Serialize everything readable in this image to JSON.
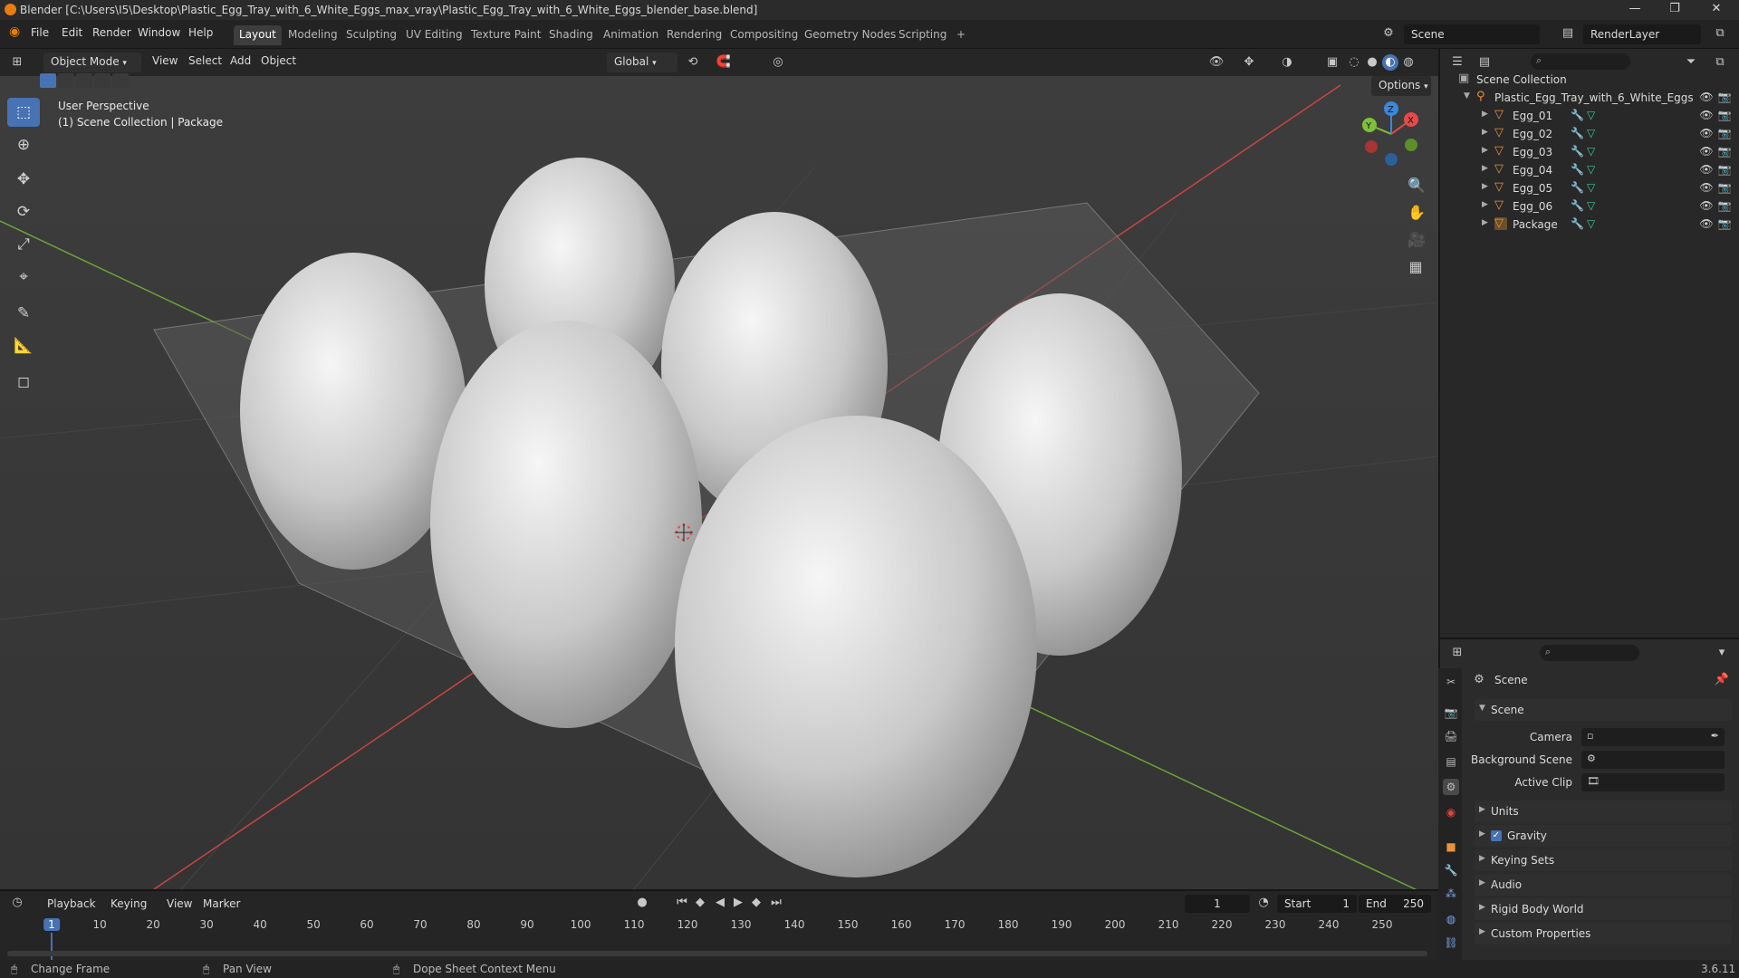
{
  "window": {
    "title": "Blender [C:\\Users\\I5\\Desktop\\Plastic_Egg_Tray_with_6_White_Eggs_max_vray\\Plastic_Egg_Tray_with_6_White_Eggs_blender_base.blend]"
  },
  "menubar": {
    "items": [
      "File",
      "Edit",
      "Render",
      "Window",
      "Help"
    ]
  },
  "workspaces": {
    "tabs": [
      "Layout",
      "Modeling",
      "Sculpting",
      "UV Editing",
      "Texture Paint",
      "Shading",
      "Animation",
      "Rendering",
      "Compositing",
      "Geometry Nodes",
      "Scripting"
    ],
    "active": "Layout",
    "add": "+"
  },
  "scene_selector": {
    "scene": "Scene",
    "view_layer": "RenderLayer"
  },
  "viewport_header": {
    "mode": "Object Mode",
    "menus": [
      "View",
      "Select",
      "Add",
      "Object"
    ],
    "transform_orientation": "Global",
    "options": "Options"
  },
  "viewport": {
    "perspective": "User Perspective",
    "collection_info": "(1) Scene Collection | Package",
    "gizmo_axes": [
      "X",
      "Y",
      "Z"
    ]
  },
  "outliner": {
    "root": "Scene Collection",
    "collection": "Plastic_Egg_Tray_with_6_White_Eggs",
    "objects": [
      "Egg_01",
      "Egg_02",
      "Egg_03",
      "Egg_04",
      "Egg_05",
      "Egg_06",
      "Package"
    ]
  },
  "properties": {
    "context_title": "Scene",
    "panel": "Scene",
    "fields": [
      {
        "label": "Camera"
      },
      {
        "label": "Background Scene"
      },
      {
        "label": "Active Clip"
      }
    ],
    "sections": [
      "Units",
      "Gravity",
      "Keying Sets",
      "Audio",
      "Rigid Body World",
      "Custom Properties"
    ],
    "gravity_checked": true
  },
  "timeline": {
    "menus": [
      "Playback",
      "Keying",
      "View",
      "Marker"
    ],
    "current_frame": "1",
    "start_label": "Start",
    "start": "1",
    "end_label": "End",
    "end": "250",
    "ticks": [
      "1",
      "10",
      "20",
      "30",
      "40",
      "50",
      "60",
      "70",
      "80",
      "90",
      "100",
      "110",
      "120",
      "130",
      "140",
      "150",
      "160",
      "170",
      "180",
      "190",
      "200",
      "210",
      "220",
      "230",
      "240",
      "250"
    ]
  },
  "statusbar": {
    "left": "Change Frame",
    "middle": "Pan View",
    "right": "Dope Sheet Context Menu",
    "version": "3.6.11"
  },
  "colors": {
    "accent": "#4772b3",
    "current_frame": "#4772b3",
    "object_orange": "#e8943d",
    "mesh_green": "#3fc4a0",
    "axis_x": "#e54a4a",
    "axis_y": "#7fbf3a",
    "axis_z": "#3b88dd"
  }
}
